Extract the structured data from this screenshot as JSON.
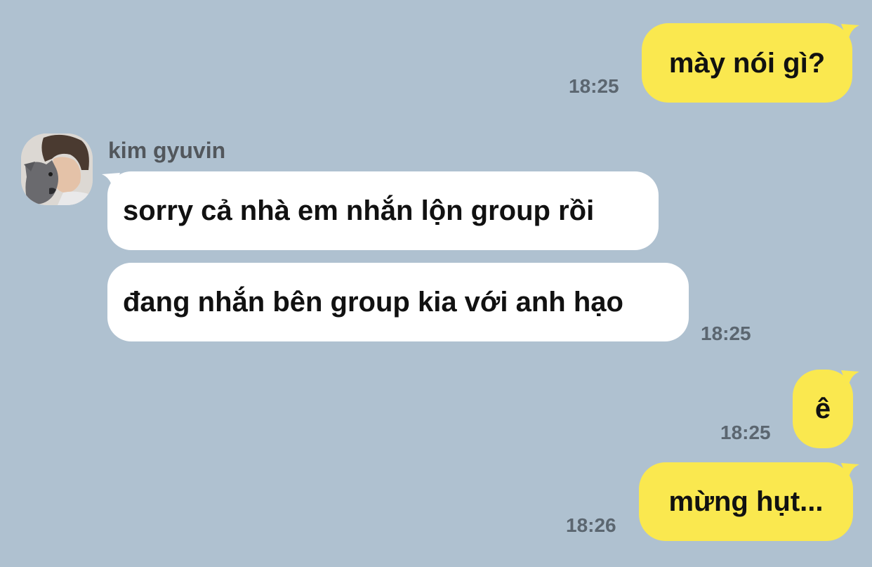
{
  "chat": {
    "sender_name": "kim gyuvin",
    "messages": [
      {
        "direction": "outgoing",
        "text": "mày nói gì?",
        "time": "18:25"
      },
      {
        "direction": "incoming",
        "text": "sorry cả nhà em nhắn lộn group rồi"
      },
      {
        "direction": "incoming",
        "text": "đang nhắn bên group kia với anh hạo",
        "time": "18:25"
      },
      {
        "direction": "outgoing",
        "text": "ê",
        "time": "18:25"
      },
      {
        "direction": "outgoing",
        "text": "mừng hụt...",
        "time": "18:26"
      }
    ]
  },
  "colors": {
    "background": "#afc1d0",
    "outgoing_bubble": "#fae84f",
    "incoming_bubble": "#ffffff",
    "timestamp": "#5b6670",
    "sender_name": "#52575c"
  },
  "icons": {
    "avatar": "profile-photo-person-with-dog"
  }
}
